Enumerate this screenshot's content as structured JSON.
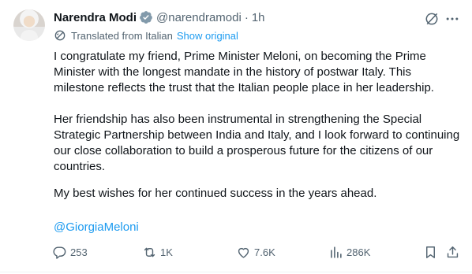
{
  "author": {
    "name": "Narendra Modi",
    "handle": "@narendramodi",
    "separator": "·",
    "time": "1h"
  },
  "translation": {
    "label": "Translated from Italian",
    "show_original": "Show original"
  },
  "content": {
    "paragraph1": "I congratulate my friend, Prime Minister Meloni, on becoming the Prime Minister with the longest mandate in the history of postwar Italy. This milestone reflects the trust that the Italian people place in her leadership.",
    "paragraph2": "Her friendship has also been instrumental in strengthening the Special Strategic Partnership between India and Italy, and I look forward to continuing our close collaboration to build a prosperous future for the citizens of our countries.",
    "paragraph3": "My best wishes for her continued success in the years ahead.",
    "mention": "@GiorgiaMeloni"
  },
  "actions": {
    "replies": "253",
    "reposts": "1K",
    "likes": "7.6K",
    "views": "286K"
  },
  "colors": {
    "accent": "#1d9bf0",
    "text": "#0f1419",
    "muted": "#536471",
    "verified": "#1d9bf0"
  },
  "icons": [
    "verified-badge-icon",
    "grok-icon",
    "more-icon",
    "translate-icon",
    "reply-icon",
    "repost-icon",
    "like-icon",
    "views-icon",
    "bookmark-icon",
    "share-icon"
  ]
}
